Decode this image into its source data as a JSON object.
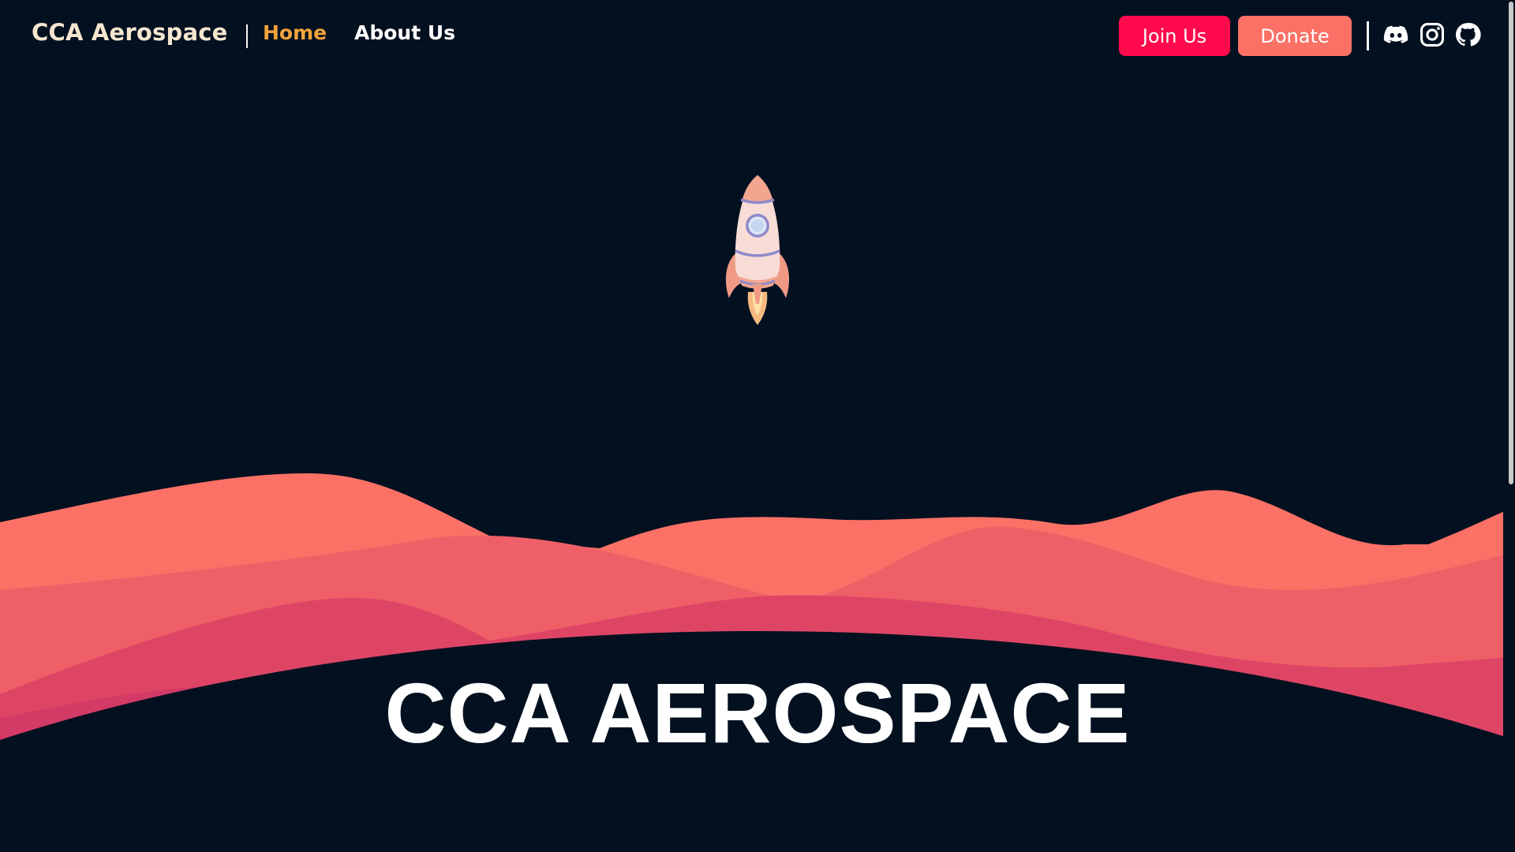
{
  "nav": {
    "brand": "CCA Aerospace",
    "links": [
      {
        "label": "Home",
        "active": true
      },
      {
        "label": "About Us",
        "active": false
      }
    ],
    "join_label": "Join Us",
    "donate_label": "Donate",
    "socials": [
      "discord-icon",
      "instagram-icon",
      "github-icon"
    ]
  },
  "hero": {
    "title": "CCA AEROSPACE"
  },
  "colors": {
    "background": "#021020",
    "brand_text": "#f5e6cf",
    "active_link": "#f2a33a",
    "join_button": "#ff0a4c",
    "donate_button": "#fb7166",
    "dune_front": "#fb7166",
    "dune_mid": "#ee5f67",
    "dune_back": "#de4565"
  }
}
